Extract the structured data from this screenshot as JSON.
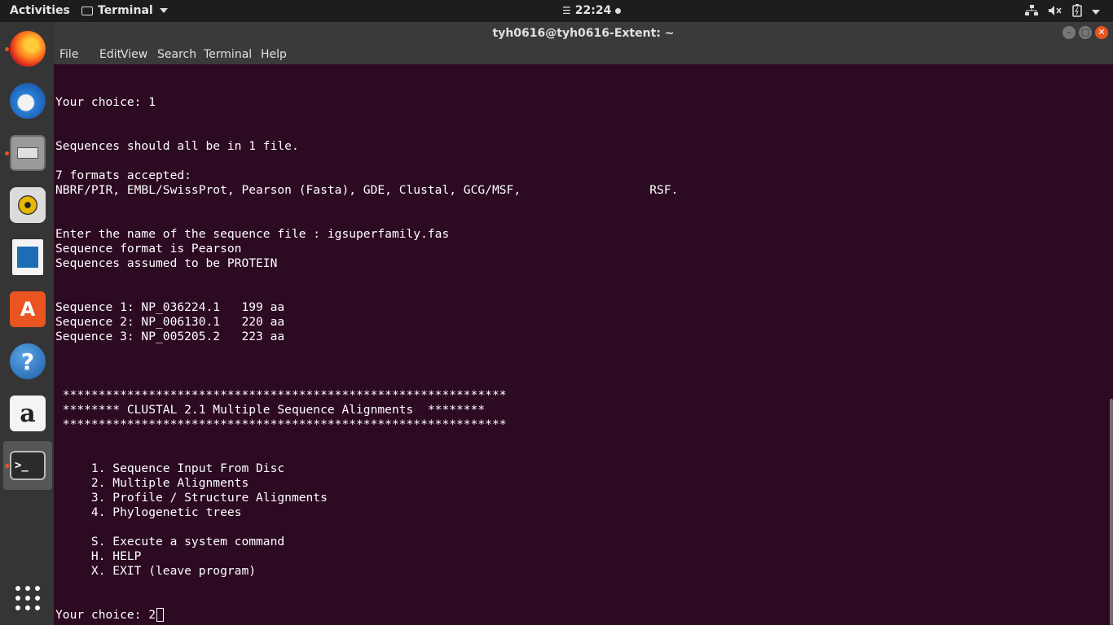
{
  "topbar": {
    "activities": "Activities",
    "app_name": "Terminal",
    "clock": "22:24"
  },
  "window": {
    "title": "tyh0616@tyh0616-Extent: ~",
    "menu": [
      "File",
      "Edit",
      "View",
      "Search",
      "Terminal",
      "Help"
    ]
  },
  "dock": {
    "items": [
      "firefox-icon",
      "thunderbird-icon",
      "files-icon",
      "rhythmbox-icon",
      "libreoffice-writer-icon",
      "software-center-icon",
      "help-icon",
      "amazon-icon",
      "terminal-icon",
      "show-apps-icon"
    ]
  },
  "terminal": {
    "lines": [
      "Your choice: 1",
      "",
      "",
      "Sequences should all be in 1 file.",
      "",
      "7 formats accepted:",
      "NBRF/PIR, EMBL/SwissProt, Pearson (Fasta), GDE, Clustal, GCG/MSF,                  RSF.",
      "",
      "",
      "Enter the name of the sequence file : igsuperfamily.fas",
      "Sequence format is Pearson",
      "Sequences assumed to be PROTEIN",
      "",
      "",
      "Sequence 1: NP_036224.1   199 aa",
      "Sequence 2: NP_006130.1   220 aa",
      "Sequence 3: NP_005205.2   223 aa",
      "",
      "",
      "",
      " **************************************************************",
      " ******** CLUSTAL 2.1 Multiple Sequence Alignments  ********",
      " **************************************************************",
      "",
      "",
      "     1. Sequence Input From Disc",
      "     2. Multiple Alignments",
      "     3. Profile / Structure Alignments",
      "     4. Phylogenetic trees",
      "",
      "     S. Execute a system command",
      "     H. HELP",
      "     X. EXIT (leave program)",
      "",
      ""
    ],
    "prompt": "Your choice: 2"
  }
}
